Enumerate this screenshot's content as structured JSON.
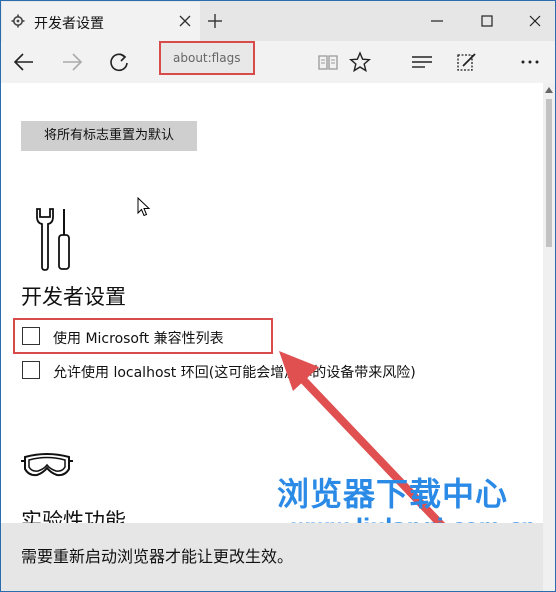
{
  "tab": {
    "title": "开发者设置",
    "favicon": "gear-icon",
    "close": "close-icon"
  },
  "titlebar": {
    "new_tab": "plus-icon",
    "minimize": "minimize-icon",
    "maximize": "maximize-icon",
    "close": "close-icon"
  },
  "toolbar": {
    "address": "about:flags",
    "back": "back-arrow-icon",
    "forward": "forward-arrow-icon",
    "refresh": "refresh-icon",
    "reading_view": "book-icon",
    "favorite": "star-icon",
    "hub": "hub-icon",
    "note": "pen-note-icon",
    "more": "more-icon"
  },
  "content": {
    "reset_label": "将所有标志重置为默认",
    "developer_section": {
      "icon": "tools-icon",
      "title": "开发者设置",
      "options": [
        {
          "label": "使用 Microsoft 兼容性列表",
          "checked": false
        },
        {
          "label": "允许使用 localhost 环回(这可能会增加你的设备带来风险)",
          "checked": false
        }
      ]
    },
    "experimental_section": {
      "icon": "goggles-icon",
      "title": "实验性功能"
    },
    "notification": "需要重新启动浏览器才能让更改生效。"
  },
  "watermark": {
    "title": "浏览器下载中心",
    "url": "www.liulanqi.com.cn"
  },
  "colors": {
    "highlight": "#d94a4a",
    "watermark": "#2a8ae6",
    "chrome": "#f2f2f2"
  }
}
